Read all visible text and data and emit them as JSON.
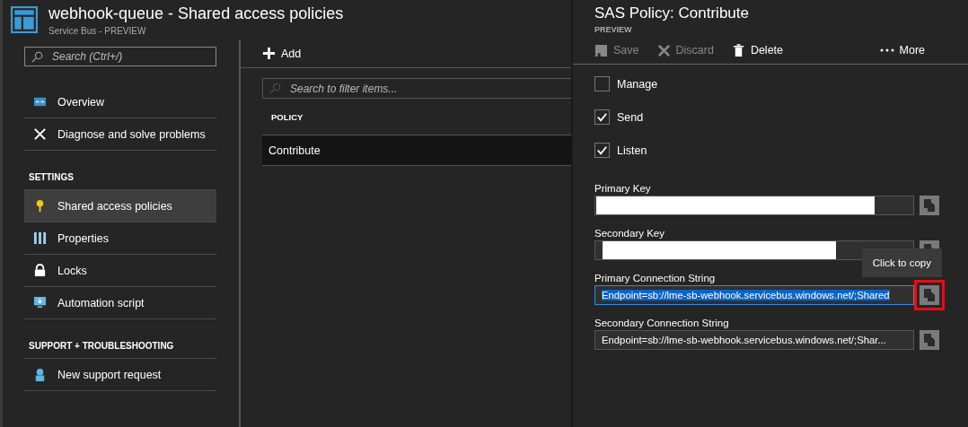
{
  "blade": {
    "title": "webhook-queue - Shared access policies",
    "subtitle": "Service Bus - PREVIEW"
  },
  "sidebar": {
    "search": {
      "placeholder": "Search (Ctrl+/)"
    },
    "sections": [
      {
        "items": [
          {
            "label": "Overview",
            "selected": false
          },
          {
            "label": "Diagnose and solve problems",
            "selected": false
          }
        ]
      },
      {
        "header": "SETTINGS",
        "items": [
          {
            "label": "Shared access policies",
            "selected": true
          },
          {
            "label": "Properties",
            "selected": false
          },
          {
            "label": "Locks",
            "selected": false
          },
          {
            "label": "Automation script",
            "selected": false
          }
        ]
      },
      {
        "header": "SUPPORT + TROUBLESHOOTING",
        "items": [
          {
            "label": "New support request",
            "selected": false
          }
        ]
      }
    ]
  },
  "policies": {
    "toolbar": [
      {
        "label": "Add"
      }
    ],
    "filter": {
      "placeholder": "Search to filter items..."
    },
    "columns": [
      "POLICY"
    ],
    "rows": [
      {
        "cells": [
          "Contribute"
        ],
        "selected": true
      }
    ]
  },
  "policy_panel": {
    "title": "SAS Policy: Contribute",
    "subtitle": "PREVIEW",
    "toolbar": [
      {
        "label": "Save",
        "disabled": true
      },
      {
        "label": "Discard",
        "disabled": true
      },
      {
        "label": "Delete",
        "disabled": false
      },
      {
        "label": "More",
        "disabled": false
      }
    ],
    "claims": [
      {
        "label": "Manage",
        "checked": false
      },
      {
        "label": "Send",
        "checked": true
      },
      {
        "label": "Listen",
        "checked": true
      }
    ],
    "fields": [
      {
        "label": "Primary Key",
        "kind": "redacted",
        "copy_highlighted": false
      },
      {
        "label": "Secondary Key",
        "kind": "redacted",
        "copy_highlighted": false
      },
      {
        "label": "Primary Connection String",
        "kind": "text",
        "value": "Endpoint=sb://lme-sb-webhook.servicebus.windows.net/;Shared",
        "selected": true,
        "copy_highlighted": true
      },
      {
        "label": "Secondary Connection String",
        "kind": "text",
        "value": "Endpoint=sb://lme-sb-webhook.servicebus.windows.net/;Shar...",
        "selected": false,
        "copy_highlighted": false
      }
    ],
    "tooltip": "Click to copy"
  }
}
